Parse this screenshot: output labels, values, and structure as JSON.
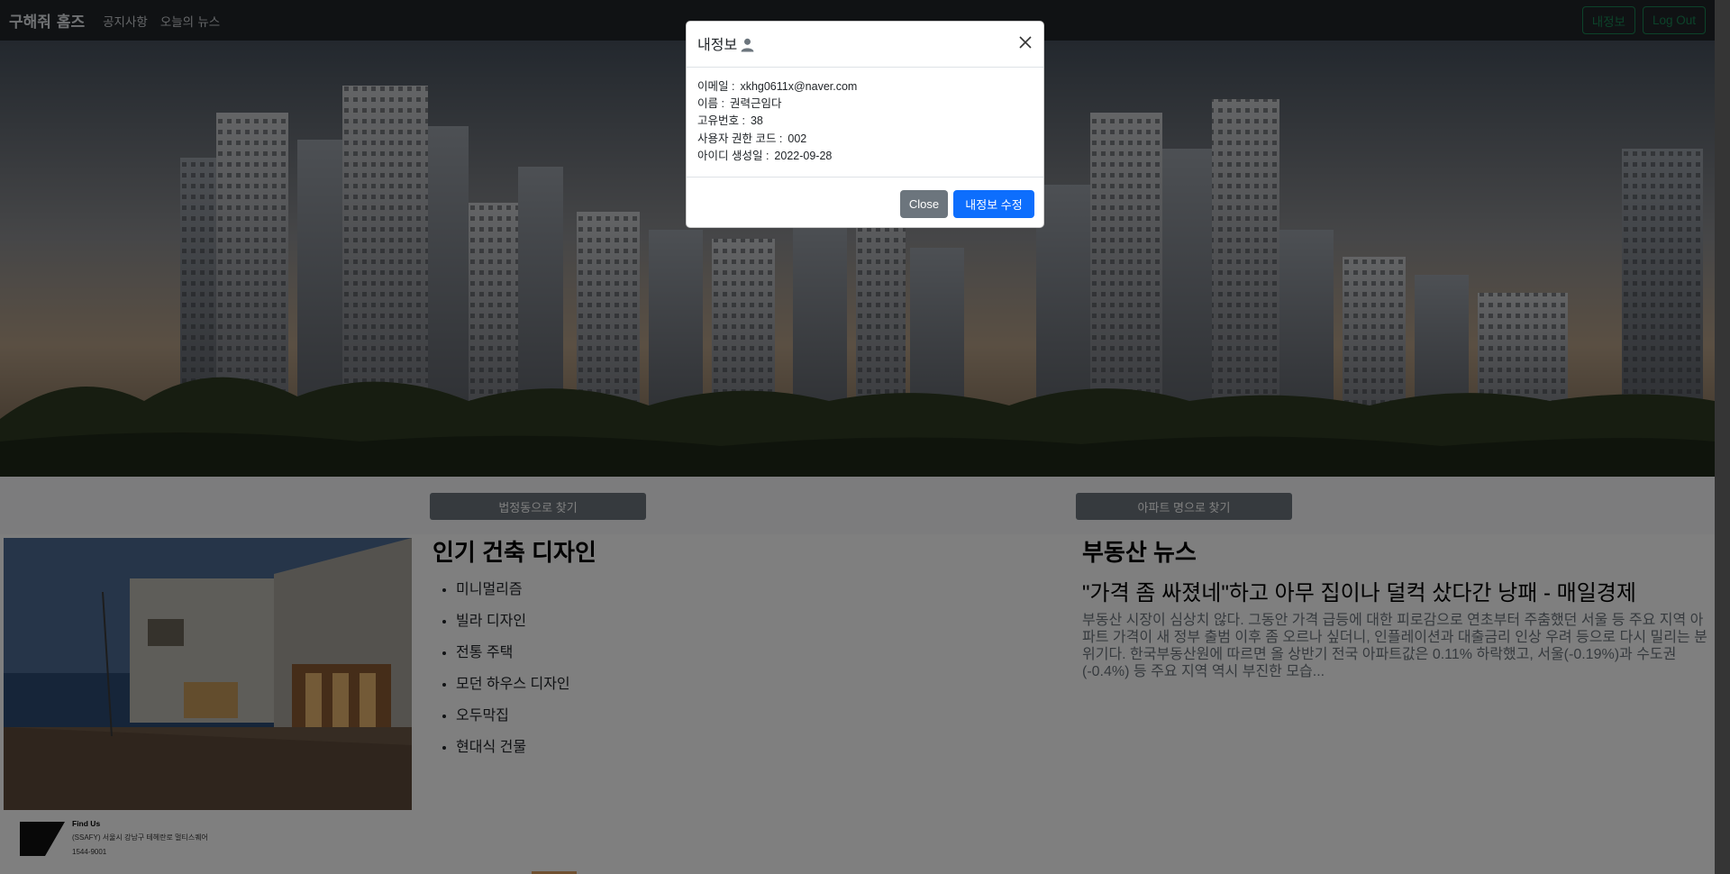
{
  "navbar": {
    "brand": "구해줘 홈즈",
    "links": [
      "공지사항",
      "오늘의 뉴스"
    ],
    "my_info_label": "내정보",
    "logout_label": "Log Out"
  },
  "search": {
    "by_dong_label": "법정동으로 찾기",
    "by_apt_label": "아파트 명으로 찾기"
  },
  "design": {
    "title": "인기 건축 디자인",
    "items": [
      "미니멀리즘",
      "빌라 디자인",
      "전통 주택",
      "모던 하우스 디자인",
      "오두막집",
      "현대식 건물"
    ]
  },
  "news": {
    "title": "부동산 뉴스",
    "headline": "\"가격 좀 싸졌네\"하고 아무 집이나 덜컥 샀다간 낭패 - 매일경제",
    "body": "부동산 시장이 심상치 않다. 그동안 가격 급등에 대한 피로감으로 연초부터 주춤했던 서울 등 주요 지역 아파트 가격이 새 정부 출범 이후 좀 오르나 싶더니, 인플레이션과 대출금리 인상 우려 등으로 다시 밀리는 분위기다. 한국부동산원에 따르면 올 상반기 전국 아파트값은 0.11% 하락했고, 서울(-0.19%)과 수도권(-0.4%) 등 주요 지역 역시 부진한 모습..."
  },
  "footer": {
    "heading": "Find Us",
    "address": "(SSAFY) 서울시 강남구 테헤란로 멀티스퀘어",
    "phone": "1544-9001"
  },
  "modal": {
    "title": "내정보",
    "fields": [
      {
        "label": "이메일 :",
        "value": "xkhg0611x@naver.com"
      },
      {
        "label": "이름 :",
        "value": "권력근임다"
      },
      {
        "label": "고유번호 :",
        "value": "38"
      },
      {
        "label": "사용자 권한 코드 :",
        "value": "002"
      },
      {
        "label": "아이디 생성일 :",
        "value": "2022-09-28"
      }
    ],
    "close_label": "Close",
    "edit_label": "내정보 수정"
  },
  "colors": {
    "navbar_bg": "#212529",
    "primary": "#0d6efd",
    "secondary": "#6c757d",
    "success": "#198754"
  }
}
